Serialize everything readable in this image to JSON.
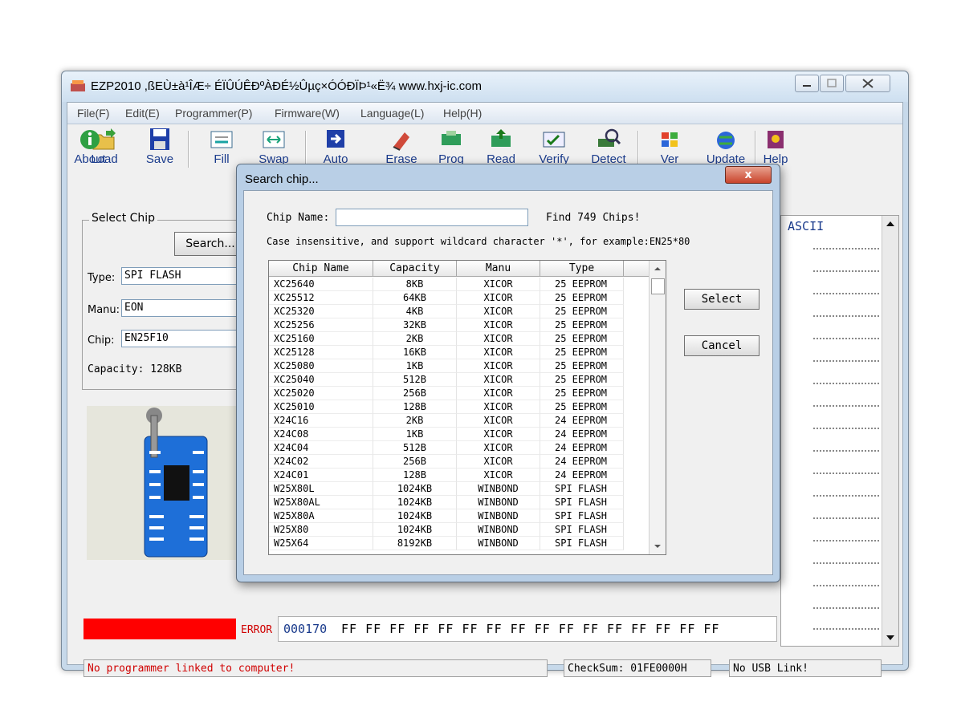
{
  "window": {
    "title": "EZP2010 ,ßEÙ±à¹ÎÆ÷ ÉÏÛÚÊÐºÀÐÉ½Ûµç×ÓÓÐÏÞ¹«Ë¾ www.hxj-ic.com",
    "controls": [
      "minimize",
      "maximize",
      "close"
    ]
  },
  "menu": [
    "File(F)",
    "Edit(E)",
    "Programmer(P)",
    "Firmware(W)",
    "Language(L)",
    "Help(H)"
  ],
  "toolbar": [
    {
      "label": "Load",
      "icon": "folder-open-icon"
    },
    {
      "label": "Save",
      "icon": "floppy-disk-icon"
    },
    {
      "label": "Fill",
      "icon": "fill-icon"
    },
    {
      "label": "Swap",
      "icon": "swap-icon"
    },
    {
      "label": "Auto",
      "icon": "auto-arrow-icon"
    },
    {
      "label": "Erase",
      "icon": "eraser-icon"
    },
    {
      "label": "Prog",
      "icon": "program-chip-icon"
    },
    {
      "label": "Read",
      "icon": "read-chip-icon"
    },
    {
      "label": "Verify",
      "icon": "verify-icon"
    },
    {
      "label": "Detect",
      "icon": "magnifier-chip-icon"
    },
    {
      "label": "Ver",
      "icon": "windows-flag-icon"
    },
    {
      "label": "Update",
      "icon": "globe-update-icon"
    },
    {
      "label": "Help",
      "icon": "help-book-icon"
    },
    {
      "label": "About",
      "icon": "info-icon"
    }
  ],
  "select_chip": {
    "legend": "Select Chip",
    "search_button": "Search...",
    "type_label": "Type:",
    "type_value": "SPI FLASH",
    "manu_label": "Manu:",
    "manu_value": "EON",
    "chip_label": "Chip:",
    "chip_value": "EN25F10",
    "capacity": "Capacity: 128KB"
  },
  "hex": {
    "ascii_header": "ASCII",
    "error_label": "ERROR",
    "address": "000170",
    "bytes": "FF FF FF FF FF FF FF FF FF FF FF FF FF FF FF FF"
  },
  "status": {
    "message": "No programmer linked to computer!",
    "checksum": "CheckSum: 01FE0000H",
    "usb": "No USB Link!"
  },
  "colors": {
    "error_red": "#ff0000",
    "link_blue": "#1a3b8c"
  },
  "dialog": {
    "title": "Search chip...",
    "close": "x",
    "chip_name_label": "Chip Name:",
    "chip_name_value": "",
    "found": "Find 749 Chips!",
    "hint": "Case insensitive, and support wildcard character '*', for example:EN25*80",
    "select_button": "Select",
    "cancel_button": "Cancel",
    "columns": [
      "Chip Name",
      "Capacity",
      "Manu",
      "Type"
    ],
    "rows": [
      [
        "XC25640",
        "8KB",
        "XICOR",
        "25 EEPROM"
      ],
      [
        "XC25512",
        "64KB",
        "XICOR",
        "25 EEPROM"
      ],
      [
        "XC25320",
        "4KB",
        "XICOR",
        "25 EEPROM"
      ],
      [
        "XC25256",
        "32KB",
        "XICOR",
        "25 EEPROM"
      ],
      [
        "XC25160",
        "2KB",
        "XICOR",
        "25 EEPROM"
      ],
      [
        "XC25128",
        "16KB",
        "XICOR",
        "25 EEPROM"
      ],
      [
        "XC25080",
        "1KB",
        "XICOR",
        "25 EEPROM"
      ],
      [
        "XC25040",
        "512B",
        "XICOR",
        "25 EEPROM"
      ],
      [
        "XC25020",
        "256B",
        "XICOR",
        "25 EEPROM"
      ],
      [
        "XC25010",
        "128B",
        "XICOR",
        "25 EEPROM"
      ],
      [
        "X24C16",
        "2KB",
        "XICOR",
        "24 EEPROM"
      ],
      [
        "X24C08",
        "1KB",
        "XICOR",
        "24 EEPROM"
      ],
      [
        "X24C04",
        "512B",
        "XICOR",
        "24 EEPROM"
      ],
      [
        "X24C02",
        "256B",
        "XICOR",
        "24 EEPROM"
      ],
      [
        "X24C01",
        "128B",
        "XICOR",
        "24 EEPROM"
      ],
      [
        "W25X80L",
        "1024KB",
        "WINBOND",
        "SPI FLASH"
      ],
      [
        "W25X80AL",
        "1024KB",
        "WINBOND",
        "SPI FLASH"
      ],
      [
        "W25X80A",
        "1024KB",
        "WINBOND",
        "SPI FLASH"
      ],
      [
        "W25X80",
        "1024KB",
        "WINBOND",
        "SPI FLASH"
      ],
      [
        "W25X64",
        "8192KB",
        "WINBOND",
        "SPI FLASH"
      ]
    ]
  }
}
